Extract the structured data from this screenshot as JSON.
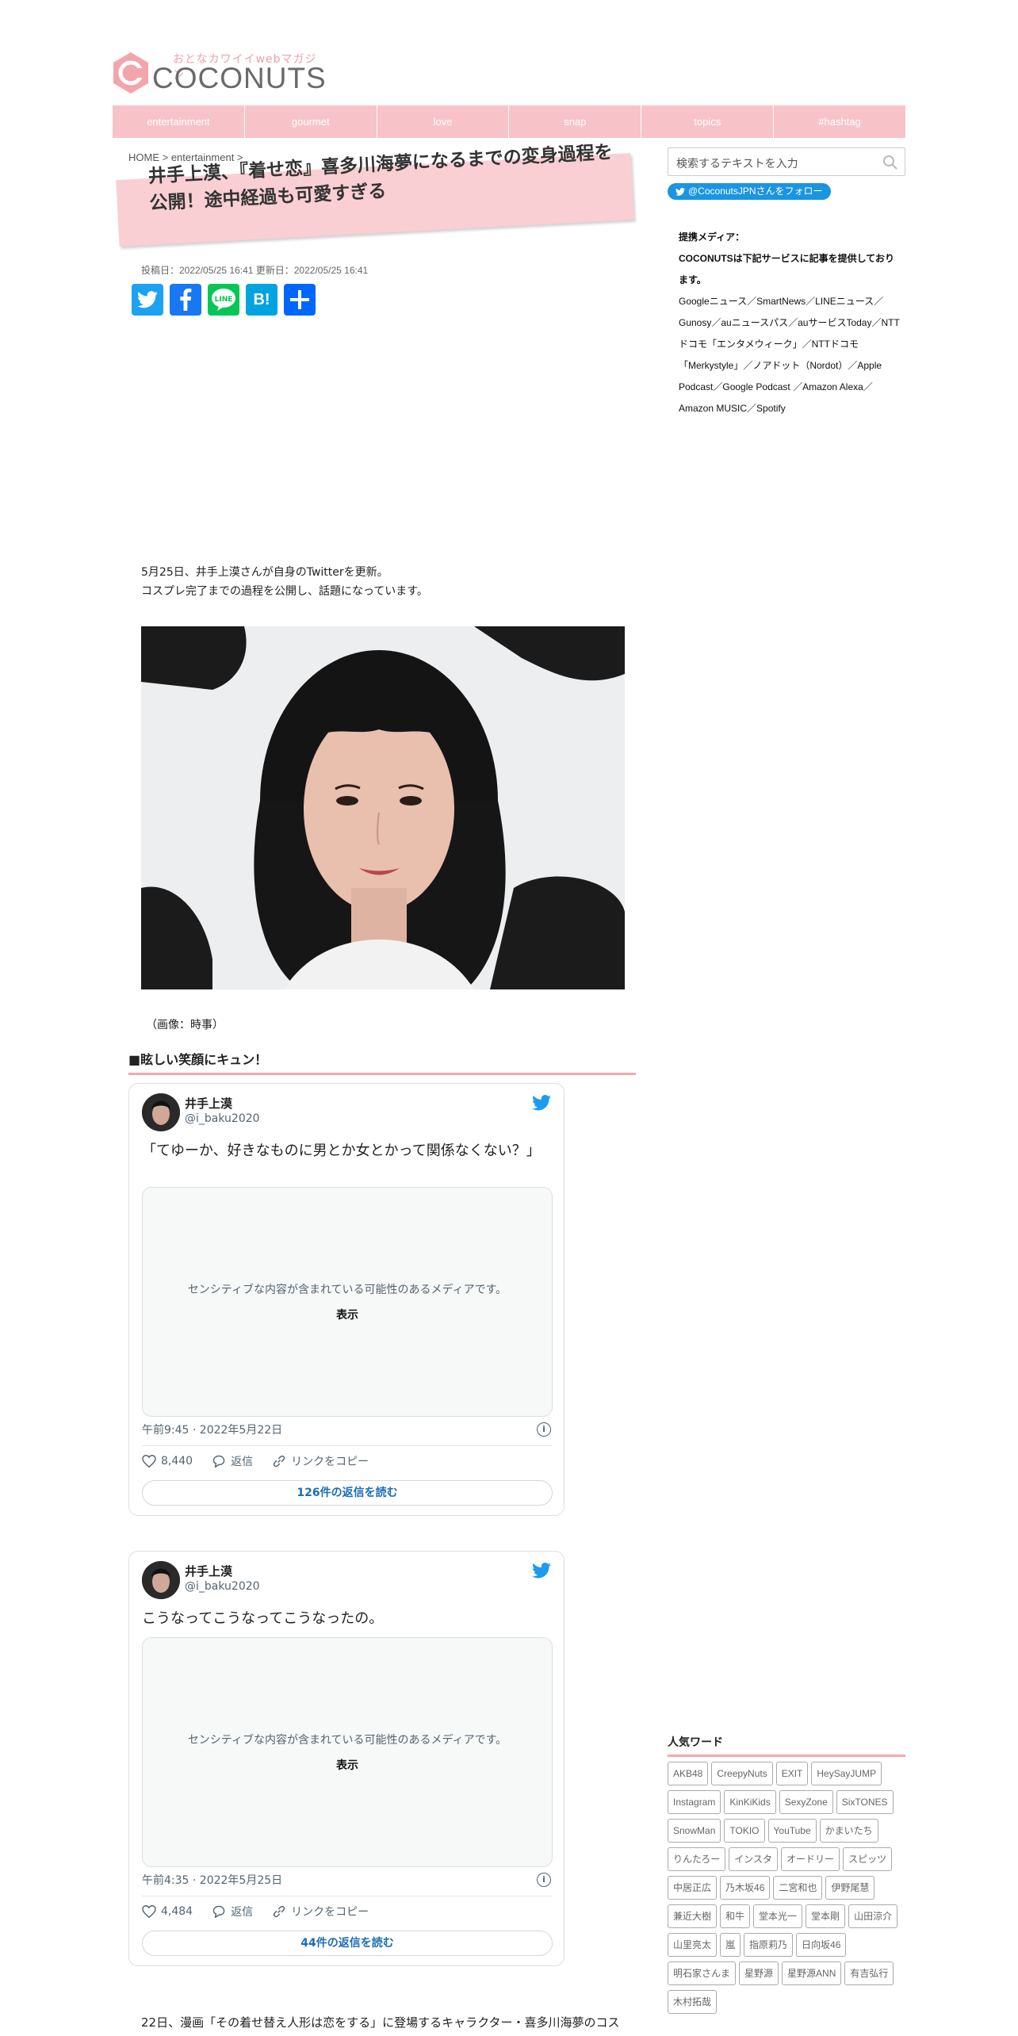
{
  "header": {
    "tagline": "おとなカワイイwebマガジン",
    "brand": "COCONUTS",
    "nav": [
      "entertainment",
      "gourmet",
      "love",
      "snap",
      "topics",
      "#hashtag"
    ]
  },
  "breadcrumb": "HOME > entertainment >",
  "article": {
    "title": "井手上漠、『着せ恋』喜多川海夢になるまでの変身過程を公開！途中経過も可愛すぎる",
    "dates": "投稿日：2022/05/25 16:41 更新日：2022/05/25 16:41",
    "lead_1": "5月25日、井手上漠さんが自身のTwitterを更新。",
    "lead_2": "コスプレ完了までの過程を公開し、話題になっています。",
    "photo_credit": "（画像：時事）",
    "section_heading": "■眩しい笑顔にキュン！",
    "bottom_text": "22日、漫画「その着せ替え人形は恋をする」に登場するキャラクター・喜多川海夢のコス"
  },
  "share": {
    "buttons": [
      {
        "name": "twitter",
        "color": "#1da1f2"
      },
      {
        "name": "facebook",
        "color": "#1877f2"
      },
      {
        "name": "line",
        "color": "#06c755"
      },
      {
        "name": "hatena",
        "color": "#00a4de"
      },
      {
        "name": "addtoany",
        "color": "#0166ff"
      }
    ],
    "line_label": "LINE",
    "hatena_label": "B!"
  },
  "tweets": [
    {
      "name": "井手上漠",
      "handle": "@i_baku2020",
      "text": "「てゆーか、好きなものに男とか女とかって関係なくない？」",
      "media_msg": "センシティブな内容が含まれている可能性のあるメディアです。",
      "media_show": "表示",
      "time": "午前9:45 · 2022年5月22日",
      "likes": "8,440",
      "reply": "返信",
      "copy": "リンクをコピー",
      "readmore": "126件の返信を読む"
    },
    {
      "name": "井手上漠",
      "handle": "@i_baku2020",
      "text": "こうなってこうなってこうなったの。",
      "media_msg": "センシティブな内容が含まれている可能性のあるメディアです。",
      "media_show": "表示",
      "time": "午前4:35 · 2022年5月25日",
      "likes": "4,484",
      "reply": "返信",
      "copy": "リンクをコピー",
      "readmore": "44件の返信を読む"
    }
  ],
  "sidebar": {
    "search_placeholder": "検索するテキストを入力",
    "follow_label": "@CoconutsJPNさんをフォロー",
    "partners_heading": "提携メディア：",
    "partners_intro": "COCONUTSは下記サービスに記事を提供しております。",
    "partners_list": "Googleニュース／SmartNews／LINEニュース／Gunosy／auニュースパス／auサービスToday／NTTドコモ「エンタメウィーク」／NTTドコモ「Merkystyle」／ノアドット（Nordot）／Apple Podcast／Google Podcast ／Amazon Alexa／Amazon MUSIC／Spotify",
    "popular_heading": "人気ワード",
    "tags": [
      "AKB48",
      "CreepyNuts",
      "EXIT",
      "HeySayJUMP",
      "Instagram",
      "KinKiKids",
      "SexyZone",
      "SixTONES",
      "SnowMan",
      "TOKIO",
      "YouTube",
      "かまいたち",
      "りんたろー",
      "インスタ",
      "オードリー",
      "スピッツ",
      "中居正広",
      "乃木坂46",
      "二宮和也",
      "伊野尾慧",
      "兼近大樹",
      "和牛",
      "堂本光一",
      "堂本剛",
      "山田涼介",
      "山里亮太",
      "嵐",
      "指原莉乃",
      "日向坂46",
      "明石家さんま",
      "星野源",
      "星野源ANN",
      "有吉弘行",
      "木村拓哉"
    ]
  }
}
